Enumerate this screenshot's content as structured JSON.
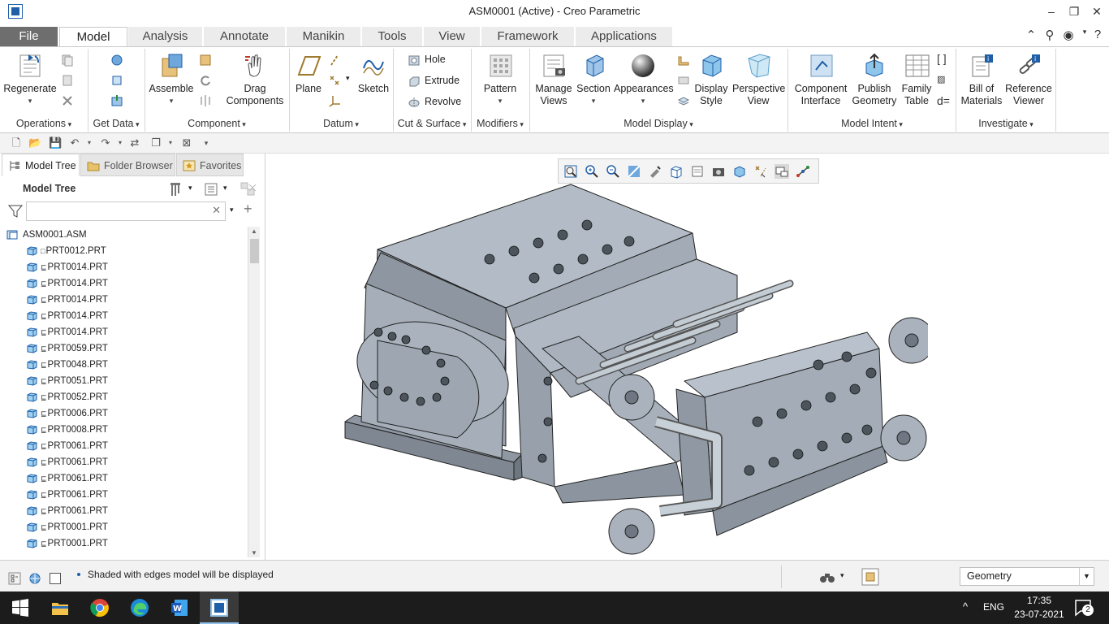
{
  "window": {
    "title": "ASM0001 (Active) - Creo Parametric"
  },
  "tabs": [
    {
      "label": "File"
    },
    {
      "label": "Model"
    },
    {
      "label": "Analysis"
    },
    {
      "label": "Annotate"
    },
    {
      "label": "Manikin"
    },
    {
      "label": "Tools"
    },
    {
      "label": "View"
    },
    {
      "label": "Framework"
    },
    {
      "label": "Applications"
    }
  ],
  "ribbon": {
    "operations": {
      "label": "Operations",
      "regenerate": "Regenerate"
    },
    "get_data": {
      "label": "Get Data"
    },
    "component": {
      "label": "Component",
      "assemble": "Assemble",
      "drag_components": "Drag\nComponents"
    },
    "datum": {
      "label": "Datum",
      "plane": "Plane",
      "sketch": "Sketch"
    },
    "cut_surface": {
      "label": "Cut & Surface",
      "hole": "Hole",
      "extrude": "Extrude",
      "revolve": "Revolve"
    },
    "modifiers": {
      "label": "Modifiers",
      "pattern": "Pattern"
    },
    "model_display": {
      "label": "Model Display",
      "manage_views": "Manage\nViews",
      "section": "Section",
      "appearances": "Appearances",
      "display_style": "Display\nStyle",
      "perspective_view": "Perspective\nView"
    },
    "model_intent": {
      "label": "Model Intent",
      "component_interface": "Component\nInterface",
      "publish_geometry": "Publish\nGeometry",
      "family_table": "Family\nTable"
    },
    "investigate": {
      "label": "Investigate",
      "bill_of_materials": "Bill of\nMaterials",
      "reference_viewer": "Reference\nViewer"
    }
  },
  "panel": {
    "tabs": {
      "model_tree": "Model Tree",
      "folder_browser": "Folder Browser",
      "favorites": "Favorites"
    },
    "title": "Model Tree",
    "search_placeholder": "",
    "root": "ASM0001.ASM",
    "items": [
      "PRT0012.PRT",
      "PRT0014.PRT",
      "PRT0014.PRT",
      "PRT0014.PRT",
      "PRT0014.PRT",
      "PRT0014.PRT",
      "PRT0059.PRT",
      "PRT0048.PRT",
      "PRT0051.PRT",
      "PRT0052.PRT",
      "PRT0006.PRT",
      "PRT0008.PRT",
      "PRT0061.PRT",
      "PRT0061.PRT",
      "PRT0061.PRT",
      "PRT0061.PRT",
      "PRT0061.PRT",
      "PRT0001.PRT",
      "PRT0001.PRT"
    ]
  },
  "status": {
    "message": "Shaded with edges model will be displayed",
    "filter_value": "Geometry"
  },
  "taskbar": {
    "language": "ENG",
    "time": "17:35",
    "date": "23-07-2021",
    "notifications": "2"
  },
  "colors": {
    "accent": "#1f5fa8",
    "model_steel": "#a7b0ba",
    "file_tab": "#6e6e6e"
  }
}
